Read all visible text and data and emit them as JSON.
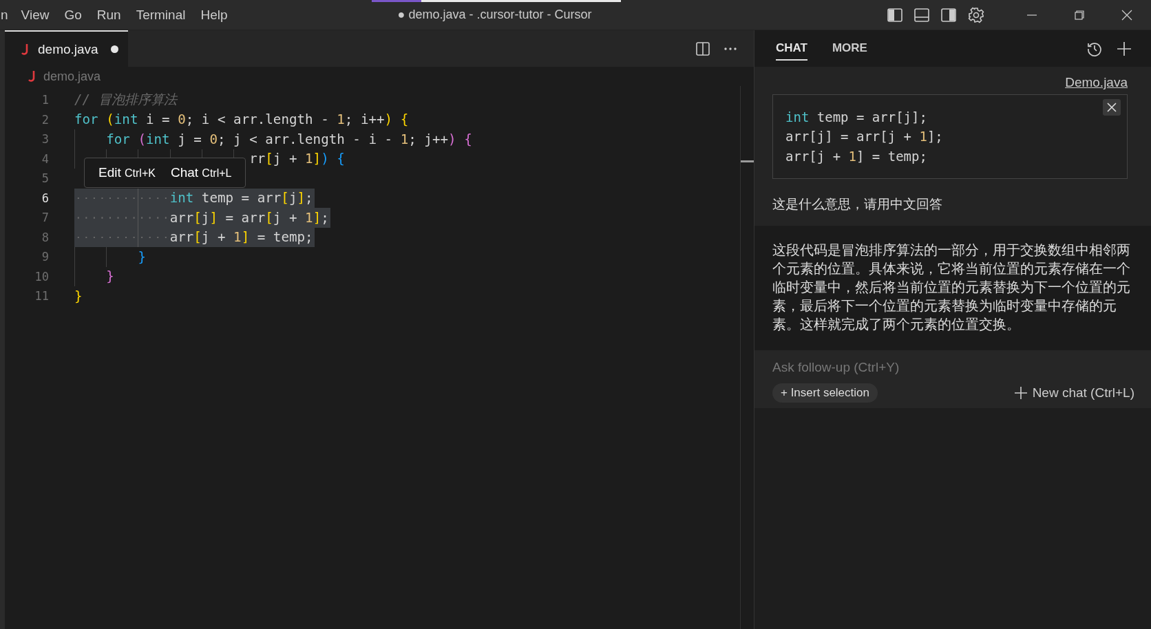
{
  "menu": [
    "n",
    "View",
    "Go",
    "Run",
    "Terminal",
    "Help"
  ],
  "title": "● demo.java - .cursor-tutor - Cursor",
  "editor": {
    "tabs": [
      {
        "label": "demo.java",
        "selected": true,
        "modified": true
      }
    ],
    "breadcrumb": "demo.java",
    "lines": [
      {
        "number": "1",
        "active": false,
        "selected": false,
        "tokens": [
          {
            "kind": "comment",
            "text": "// 冒泡排序算法"
          }
        ]
      },
      {
        "number": "2",
        "active": false,
        "selected": false,
        "tokens": [
          {
            "kind": "keyword",
            "text": "for "
          },
          {
            "kind": "bracket1",
            "text": "("
          },
          {
            "kind": "type",
            "text": "int"
          },
          {
            "kind": "plain",
            "text": " i = "
          },
          {
            "kind": "number",
            "text": "0"
          },
          {
            "kind": "plain",
            "text": "; i < arr.length - "
          },
          {
            "kind": "number",
            "text": "1"
          },
          {
            "kind": "plain",
            "text": "; i++"
          },
          {
            "kind": "bracket1",
            "text": ")"
          },
          {
            "kind": "bracket1",
            "text": " {"
          }
        ]
      },
      {
        "number": "3",
        "active": false,
        "selected": false,
        "tokens": [
          {
            "kind": "keyword",
            "text": "    for "
          },
          {
            "kind": "bracket2",
            "text": "("
          },
          {
            "kind": "type",
            "text": "int"
          },
          {
            "kind": "plain",
            "text": " j = "
          },
          {
            "kind": "number",
            "text": "0"
          },
          {
            "kind": "plain",
            "text": "; j < arr.length - i - "
          },
          {
            "kind": "number",
            "text": "1"
          },
          {
            "kind": "plain",
            "text": "; j++"
          },
          {
            "kind": "bracket2",
            "text": ")"
          },
          {
            "kind": "bracket2",
            "text": " {"
          }
        ]
      },
      {
        "number": "4",
        "active": false,
        "selected": false,
        "tokens": [
          {
            "kind": "plain",
            "text": "                      rr"
          },
          {
            "kind": "bracket1",
            "text": "["
          },
          {
            "kind": "plain",
            "text": "j + "
          },
          {
            "kind": "number",
            "text": "1"
          },
          {
            "kind": "bracket1",
            "text": "]"
          },
          {
            "kind": "bracket3",
            "text": ")"
          },
          {
            "kind": "bracket3",
            "text": " {"
          }
        ]
      },
      {
        "number": "5",
        "active": false,
        "selected": false
      },
      {
        "number": "6",
        "active": true,
        "selected": true,
        "tokens": [
          {
            "kind": "type",
            "text": "            int"
          },
          {
            "kind": "plain",
            "text": " temp = arr"
          },
          {
            "kind": "bracket1",
            "text": "["
          },
          {
            "kind": "plain",
            "text": "j"
          },
          {
            "kind": "bracket1",
            "text": "]"
          },
          {
            "kind": "plain",
            "text": ";"
          }
        ]
      },
      {
        "number": "7",
        "active": false,
        "selected": true,
        "tokens": [
          {
            "kind": "plain",
            "text": "            arr"
          },
          {
            "kind": "bracket1",
            "text": "["
          },
          {
            "kind": "plain",
            "text": "j"
          },
          {
            "kind": "bracket1",
            "text": "]"
          },
          {
            "kind": "plain",
            "text": " = arr"
          },
          {
            "kind": "bracket1",
            "text": "["
          },
          {
            "kind": "plain",
            "text": "j + "
          },
          {
            "kind": "number",
            "text": "1"
          },
          {
            "kind": "bracket1",
            "text": "]"
          },
          {
            "kind": "plain",
            "text": ";"
          }
        ]
      },
      {
        "number": "8",
        "active": false,
        "selected": true,
        "tokens": [
          {
            "kind": "plain",
            "text": "            arr"
          },
          {
            "kind": "bracket1",
            "text": "["
          },
          {
            "kind": "plain",
            "text": "j + "
          },
          {
            "kind": "number",
            "text": "1"
          },
          {
            "kind": "bracket1",
            "text": "]"
          },
          {
            "kind": "plain",
            "text": " = temp;"
          }
        ]
      },
      {
        "number": "9",
        "active": false,
        "selected": false,
        "tokens": [
          {
            "kind": "bracket3",
            "text": "        }"
          }
        ]
      },
      {
        "number": "10",
        "active": false,
        "selected": false,
        "tokens": [
          {
            "kind": "bracket2",
            "text": "    }"
          }
        ]
      },
      {
        "number": "11",
        "active": false,
        "selected": false,
        "tokens": [
          {
            "kind": "bracket1",
            "text": "}"
          }
        ]
      }
    ],
    "popup": {
      "actions": [
        {
          "label": "Edit",
          "shortcut": "Ctrl+K"
        },
        {
          "label": "Chat",
          "shortcut": "Ctrl+L"
        }
      ]
    }
  },
  "chat": {
    "tabs": [
      {
        "label": "CHAT",
        "selected": true
      },
      {
        "label": "MORE",
        "selected": false
      }
    ],
    "file_link": "Demo.java",
    "code": [
      [
        {
          "kind": "type",
          "text": "int"
        },
        {
          "kind": "plain",
          "text": " temp = arr[j];"
        }
      ],
      [
        {
          "kind": "plain",
          "text": "arr[j] = arr[j + "
        },
        {
          "kind": "number",
          "text": "1"
        },
        {
          "kind": "plain",
          "text": "];"
        }
      ],
      [
        {
          "kind": "plain",
          "text": "arr[j + "
        },
        {
          "kind": "number",
          "text": "1"
        },
        {
          "kind": "plain",
          "text": "] = temp;"
        }
      ]
    ],
    "question": "这是什么意思，请用中文回答",
    "answer": "这段代码是冒泡排序算法的一部分，用于交换数组中相邻两个元素的位置。具体来说，它将当前位置的元素存储在一个临时变量中，然后将当前位置的元素替换为下一个位置的元素，最后将下一个位置的元素替换为临时变量中存储的元素。这样就完成了两个元素的位置交换。",
    "followup": {
      "placeholder": "Ask follow-up (Ctrl+Y)"
    },
    "insert_button": "+ Insert selection",
    "new_chat": "New chat (Ctrl+L)"
  }
}
